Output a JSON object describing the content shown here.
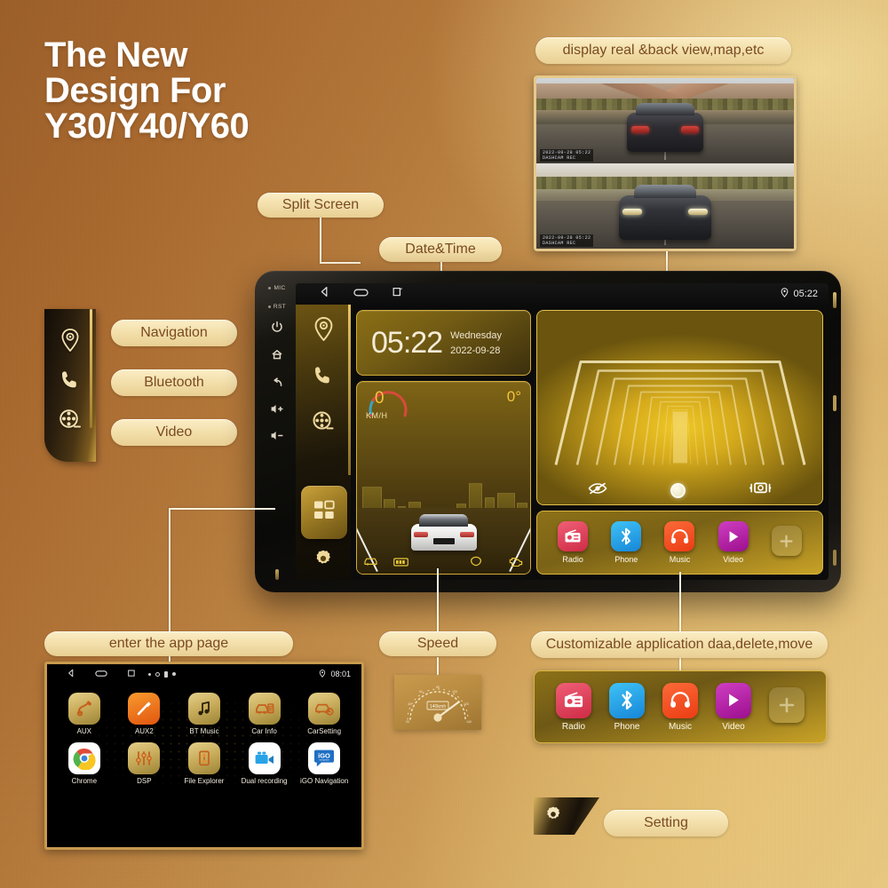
{
  "hero": {
    "title_lines": [
      "The New",
      "Design For",
      "Y30/Y40/Y60"
    ]
  },
  "callouts": {
    "camera": "display real &back view,map,etc",
    "split_screen": "Split Screen",
    "date_time": "Date&Time",
    "navigation": "Navigation",
    "bluetooth": "Bluetooth",
    "video": "Video",
    "enter_app_page": "enter the app page",
    "speed": "Speed",
    "customizable": "Customizable application daa,delete,move",
    "setting": "Setting"
  },
  "left_strip_icons": [
    "location-pin-icon",
    "phone-icon",
    "film-reel-icon"
  ],
  "device": {
    "bezel": {
      "mic_label": "MIC",
      "rst_label": "RST",
      "buttons": [
        "power-icon",
        "home-icon",
        "back-icon",
        "volume-up-icon",
        "volume-down-icon"
      ]
    },
    "status_bar": {
      "nav": [
        "back-icon",
        "home-icon",
        "recents-icon"
      ],
      "location_icon": "location-pin-icon",
      "time": "05:22"
    },
    "side_rail": {
      "items": [
        "location-pin-icon",
        "phone-icon",
        "film-reel-icon"
      ],
      "active": "apps-grid-icon",
      "settings": "gear-icon"
    },
    "clock_widget": {
      "time": "05:22",
      "weekday": "Wednesday",
      "date": "2022-09-28"
    },
    "speed_widget": {
      "speed": "0",
      "unit": "KM/H",
      "heading": "0°",
      "status_icons": [
        "car-door-icon",
        "seatbelt-icon",
        "airbag-icon",
        "engine-icon"
      ]
    },
    "media_widget": {
      "controls": [
        "eye-off-icon",
        "shutter-button",
        "camera-switch-icon"
      ]
    },
    "dock": {
      "apps": [
        {
          "label": "Radio",
          "icon": "radio-icon",
          "color": "#e2445c"
        },
        {
          "label": "Phone",
          "icon": "bluetooth-icon",
          "color": "#22a6e8"
        },
        {
          "label": "Music",
          "icon": "headphones-icon",
          "color": "#f4511e"
        },
        {
          "label": "Video",
          "icon": "play-icon",
          "color": "#b4249e"
        },
        {
          "label": "",
          "icon": "plus-icon",
          "color": "rgba(255,255,255,0.12)"
        }
      ]
    }
  },
  "app_page": {
    "status": {
      "time": "08:01",
      "location_icon": "location-pin-icon"
    },
    "rows": [
      [
        {
          "label": "AUX",
          "icon": "aux-plug-icon"
        },
        {
          "label": "AUX2",
          "icon": "aux2-plug-icon"
        },
        {
          "label": "BT Music",
          "icon": "music-note-icon"
        },
        {
          "label": "Car Info",
          "icon": "car-info-icon"
        },
        {
          "label": "CarSetting",
          "icon": "car-setting-icon"
        }
      ],
      [
        {
          "label": "Chrome",
          "icon": "chrome-icon"
        },
        {
          "label": "DSP",
          "icon": "equalizer-icon"
        },
        {
          "label": "File Explorer",
          "icon": "file-explorer-icon"
        },
        {
          "label": "Dual recording",
          "icon": "camcorder-icon"
        },
        {
          "label": "iGO Navigation",
          "icon": "igo-navigation-icon"
        }
      ]
    ]
  },
  "speedometer": {
    "reading": "140kmh"
  },
  "colors": {
    "gold": "#e2c04a",
    "cream": "#f3e0ac",
    "brown_text": "#7a4a22",
    "accent_yellow": "#f2c43c"
  }
}
